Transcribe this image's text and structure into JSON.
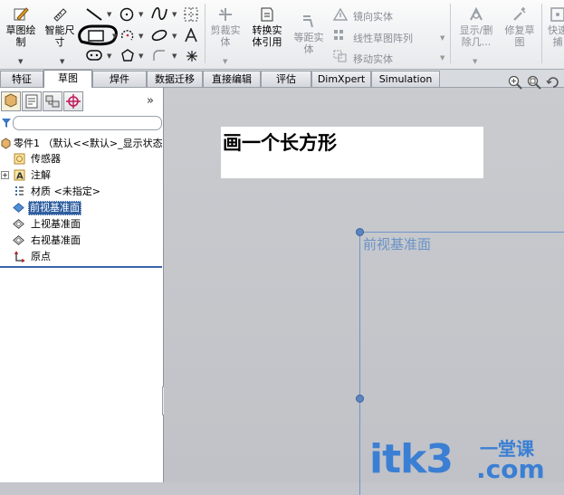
{
  "ribbon": {
    "sketch_label": "草图绘\n制",
    "smart_dim_label": "智能尺\n寸",
    "trim_label": "剪裁实\n体",
    "convert_label": "转换实\n体引用",
    "offset_label": "等距实\n体",
    "mirror_label": "镜向实体",
    "linear_pattern_label": "线性草图阵列",
    "move_label": "移动实体",
    "show_hide_label": "显示/删\n除几...",
    "repair_label": "修复草\n图",
    "quick_label": "快速\n捕"
  },
  "tabs": [
    "特征",
    "草图",
    "焊件",
    "数据迁移",
    "直接编辑",
    "评估",
    "DimXpert",
    "Simulation"
  ],
  "active_tab": "草图",
  "tree": {
    "root": "零件1 （默认<<默认>_显示状态",
    "items": [
      "传感器",
      "注解",
      "材质 <未指定>",
      "前视基准面",
      "上视基准面",
      "右视基准面",
      "原点"
    ],
    "selected": "前视基准面"
  },
  "canvas": {
    "annotation": "画一个长方形",
    "plane_label": "前视基准面"
  },
  "watermark": {
    "brand": "itk3",
    "suffix": ".com",
    "tagline": "一堂课"
  },
  "colors": {
    "selection": "#2e5d9f",
    "plane": "#6f94c7",
    "watermark": "#3b7fd4"
  }
}
